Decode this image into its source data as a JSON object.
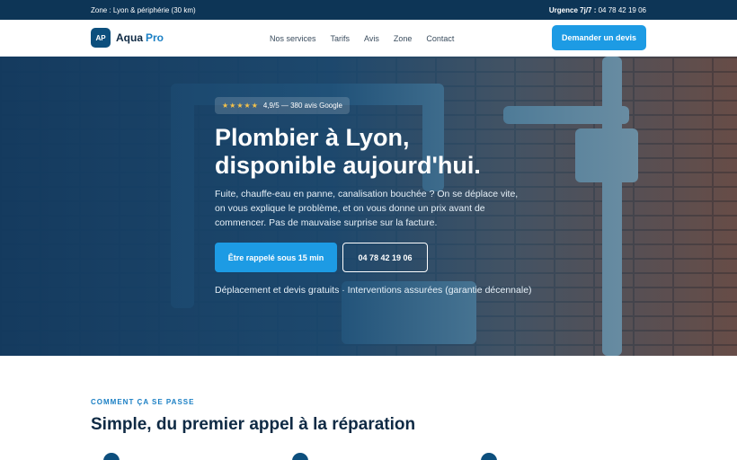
{
  "topbar": {
    "zone": "Zone : Lyon & périphérie (30 km)",
    "urgence_label": "Urgence 7j/7 :",
    "urgence_phone": "04 78 42 19 06"
  },
  "header": {
    "logo_badge": "AP",
    "logo_name": "Aqua",
    "logo_suffix": "Pro",
    "nav": [
      "Nos services",
      "Tarifs",
      "Avis",
      "Zone",
      "Contact"
    ],
    "cta": "Demander un devis"
  },
  "hero": {
    "stars": "★★★★★",
    "rating": "4,9/5 — 380 avis Google",
    "title_line1": "Plombier à Lyon,",
    "title_line2": "disponible aujourd'hui.",
    "lead": "Fuite, chauffe-eau en panne, canalisation bouchée ? On se déplace vite, on vous explique le problème, et on vous donne un prix avant de commencer. Pas de mauvaise surprise sur la facture.",
    "primary_cta": "Être rappelé sous 15 min",
    "phone_cta": "04 78 42 19 06",
    "guarantee": "Déplacement et devis gratuits · Interventions assurées (garantie décennale)"
  },
  "process": {
    "eyebrow": "COMMENT ÇA SE PASSE",
    "title": "Simple, du premier appel à la réparation"
  },
  "colors": {
    "primary": "#1d9be4",
    "navy": "#0d3556",
    "star": "#f5c24a"
  }
}
